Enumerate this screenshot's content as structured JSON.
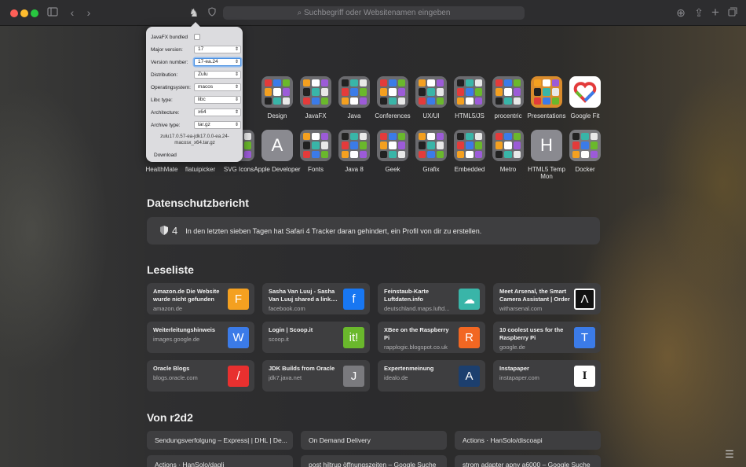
{
  "toolbar": {
    "search_placeholder": "Suchbegriff oder Websitenamen eingeben"
  },
  "favorites": [
    {
      "label": "Design"
    },
    {
      "label": "JavaFX"
    },
    {
      "label": "Java"
    },
    {
      "label": "Conferences"
    },
    {
      "label": "UX/UI"
    },
    {
      "label": "HTML5/JS"
    },
    {
      "label": "procentric"
    },
    {
      "label": "Presentations"
    },
    {
      "label": "Google Fit"
    },
    {
      "label": "HealthMate"
    },
    {
      "label": "flatuipicker"
    },
    {
      "label": "SVG Icons"
    },
    {
      "label": "Apple Developer",
      "letter": "A"
    },
    {
      "label": "Fonts"
    },
    {
      "label": "Java 8"
    },
    {
      "label": "Geek"
    },
    {
      "label": "Grafix"
    },
    {
      "label": "Embedded"
    },
    {
      "label": "Metro"
    },
    {
      "label": "HTML5 Temp Mon",
      "letter": "H"
    },
    {
      "label": "Docker"
    }
  ],
  "privacy": {
    "title": "Datenschutzbericht",
    "count": "4",
    "text": "In den letzten sieben Tagen hat Safari 4 Tracker daran gehindert, ein Profil von dir zu erstellen."
  },
  "reading": {
    "title": "Leseliste",
    "items": [
      {
        "title": "Amazon.de Die Website wurde nicht gefunden",
        "url": "amazon.de",
        "icon": "F",
        "color": "#f4a020"
      },
      {
        "title": "Sasha Van Luuj - Sasha Van Luuj shared a link....",
        "url": "facebook.com",
        "icon": "f",
        "color": "#1877f2"
      },
      {
        "title": "Feinstaub-Karte Luftdaten.info",
        "url": "deutschland.maps.luftd...",
        "icon": "☁",
        "color": "#39b5a8"
      },
      {
        "title": "Meet Arsenal, the Smart Camera Assistant | Order",
        "url": "witharsenal.com",
        "icon": "Λ",
        "color": "#111111"
      },
      {
        "title": "Weiterleitungshinweis",
        "url": "images.google.de",
        "icon": "W",
        "color": "#3b7be8"
      },
      {
        "title": "Login | Scoop.it",
        "url": "scoop.it",
        "icon": "it!",
        "color": "#6ab82c"
      },
      {
        "title": "XBee on the Raspberry Pi",
        "url": "rapplogic.blogspot.co.uk",
        "icon": "R",
        "color": "#f26722"
      },
      {
        "title": "10 coolest uses for the Raspberry Pi",
        "url": "google.de",
        "icon": "T",
        "color": "#3b7be8"
      },
      {
        "title": "Oracle Blogs",
        "url": "blogs.oracle.com",
        "icon": "/",
        "color": "#e8302f"
      },
      {
        "title": "JDK Builds from Oracle",
        "url": "jdk7.java.net",
        "icon": "J",
        "color": "#7a7a7e"
      },
      {
        "title": "Expertenmeinung",
        "url": "idealo.de",
        "icon": "A",
        "color": "#1c3f6e"
      },
      {
        "title": "Instapaper",
        "url": "instapaper.com",
        "icon": "I",
        "color": "#ffffff"
      }
    ]
  },
  "r2d2": {
    "title": "Von r2d2",
    "items": [
      "Sendungsverfolgung – Express| | DHL | De...",
      "On Demand Delivery",
      "Actions · HanSolo/discoapi",
      "Actions · HanSolo/dagli",
      "post hiltrup öffnungszeiten – Google Suche",
      "strom adapter apny a6000 – Google Suche"
    ]
  },
  "popover": {
    "bundled_label": "JavaFX bundled",
    "rows": [
      {
        "label": "Major version:",
        "value": "17"
      },
      {
        "label": "Version number:",
        "value": "17-ea.24"
      },
      {
        "label": "Distribution:",
        "value": "Zulu"
      },
      {
        "label": "Operatingsystem:",
        "value": "macos"
      },
      {
        "label": "Libc type:",
        "value": "libc"
      },
      {
        "label": "Architecture:",
        "value": "x64"
      },
      {
        "label": "Archive type:",
        "value": "tar.gz"
      }
    ],
    "filename": "zulu17.0.57-ea-jdk17.0.0-ea.24-macosx_x64.tar.gz",
    "download": "Download"
  }
}
